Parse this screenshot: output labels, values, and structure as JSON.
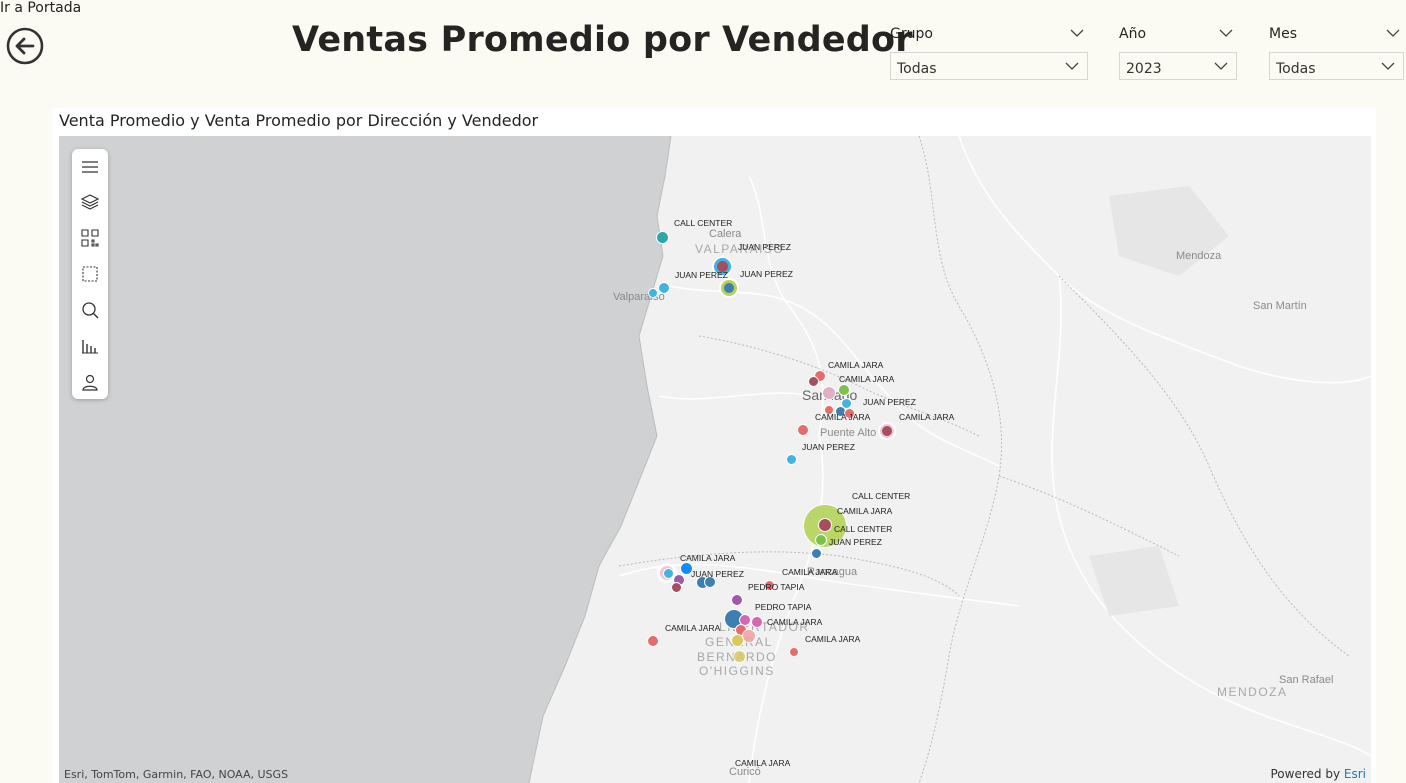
{
  "nav": {
    "goto_label": "Ir a Portada"
  },
  "header": {
    "title": "Ventas Promedio por Vendedor"
  },
  "filters": [
    {
      "label": "Grupo",
      "value": "Todas"
    },
    {
      "label": "Año",
      "value": "2023"
    },
    {
      "label": "Mes",
      "value": "Todas"
    }
  ],
  "visual": {
    "title": "Venta Promedio y Venta Promedio por Dirección y Vendedor",
    "attribution": "Esri, TomTom, Garmin, FAO, NOAA, USGS",
    "powered_by_prefix": "Powered by",
    "powered_by_brand": "Esri"
  },
  "map": {
    "toolbar": [
      "menu-icon",
      "layers-icon",
      "qr-icon",
      "select-rect-icon",
      "search-icon",
      "chart-icon",
      "person-icon"
    ],
    "places": [
      {
        "name": "Calera"
      },
      {
        "name": "VALPARAISO"
      },
      {
        "name": "Valparaíso"
      },
      {
        "name": "Mendoza"
      },
      {
        "name": "San Martín"
      },
      {
        "name": "Santiago"
      },
      {
        "name": "Puente Alto"
      },
      {
        "name": "Rancagua"
      },
      {
        "name": "LIBERTADOR"
      },
      {
        "name": "GENERAL"
      },
      {
        "name": "BERNARDO"
      },
      {
        "name": "O'HIGGINS"
      },
      {
        "name": "MENDOZA"
      },
      {
        "name": "San Rafael"
      },
      {
        "name": "Curicó"
      }
    ],
    "labels": [
      "CALL CENTER",
      "JUAN PEREZ",
      "JUAN PEREZ",
      "JUAN PEREZ",
      "CAMILA JARA",
      "CAMILA JARA",
      "JUAN PEREZ",
      "CAMILA JARA",
      "CAMILA JARA",
      "JUAN PEREZ",
      "CALL CENTER",
      "CAMILA JARA",
      "CALL CENTER",
      "JUAN PEREZ",
      "CAMILA JARA",
      "JUAN PEREZ",
      "CAMILA JARA",
      "PEDRO TAPIA",
      "PEDRO TAPIA",
      "CAMILA JARA",
      "CAMILA JARA",
      "CAMILA JARA",
      "CAMILA JARA"
    ],
    "bubble_colors": {
      "blue": "#118dff",
      "teal": "#2fa6a6",
      "sky": "#41b3e2",
      "steel": "#3c7fb0",
      "red": "#e66c6c",
      "maroon": "#a64d5e",
      "green": "#7cc24a",
      "lime": "#b5d35a",
      "purple": "#9d5aa6",
      "pink": "#d667b0",
      "yellow": "#d9c85c"
    }
  }
}
